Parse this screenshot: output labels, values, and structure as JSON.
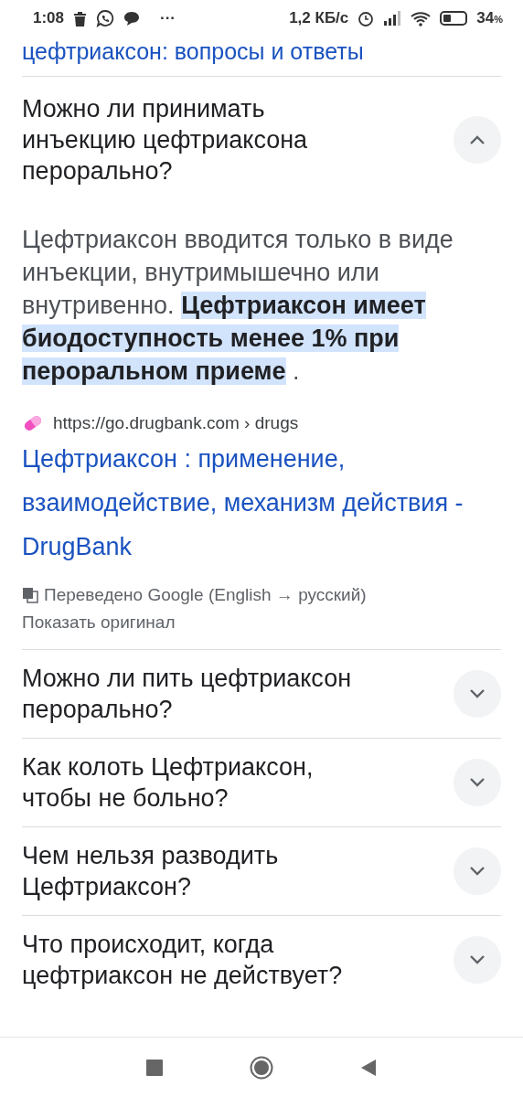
{
  "status_bar": {
    "time": "1:08",
    "more": "···",
    "speed": "1,2 КБ/с",
    "battery_percent": "34",
    "battery_unit": "%",
    "battery": {
      "level": 0.34
    }
  },
  "section_title": "цефтриаксон: вопросы и ответы",
  "questions": [
    {
      "text": "Можно ли принимать инъекцию цефтриаксона перорально?",
      "expanded": true,
      "answer": {
        "plain": "Цефтриаксон вводится только в виде инъекции, внутримышечно или внутривенно. ",
        "highlight": "Цефтриаксон имеет биодоступность менее 1% при пероральном приеме",
        "tail": " ."
      },
      "source": {
        "url": "https://go.drugbank.com › drugs",
        "title": "Цефтриаксон : применение, взаимодействие, механизм действия - DrugBank"
      },
      "translation": {
        "note": "Переведено Google (English → русский)",
        "link": "Показать оригинал"
      }
    },
    {
      "text": "Можно ли пить цефтриаксон перорально?",
      "expanded": false
    },
    {
      "text": "Как колоть Цефтриаксон, чтобы не больно?",
      "expanded": false
    },
    {
      "text": "Чем нельзя разводить Цефтриаксон?",
      "expanded": false
    },
    {
      "text": "Что происходит, когда цефтриаксон не действует?",
      "expanded": false
    }
  ]
}
